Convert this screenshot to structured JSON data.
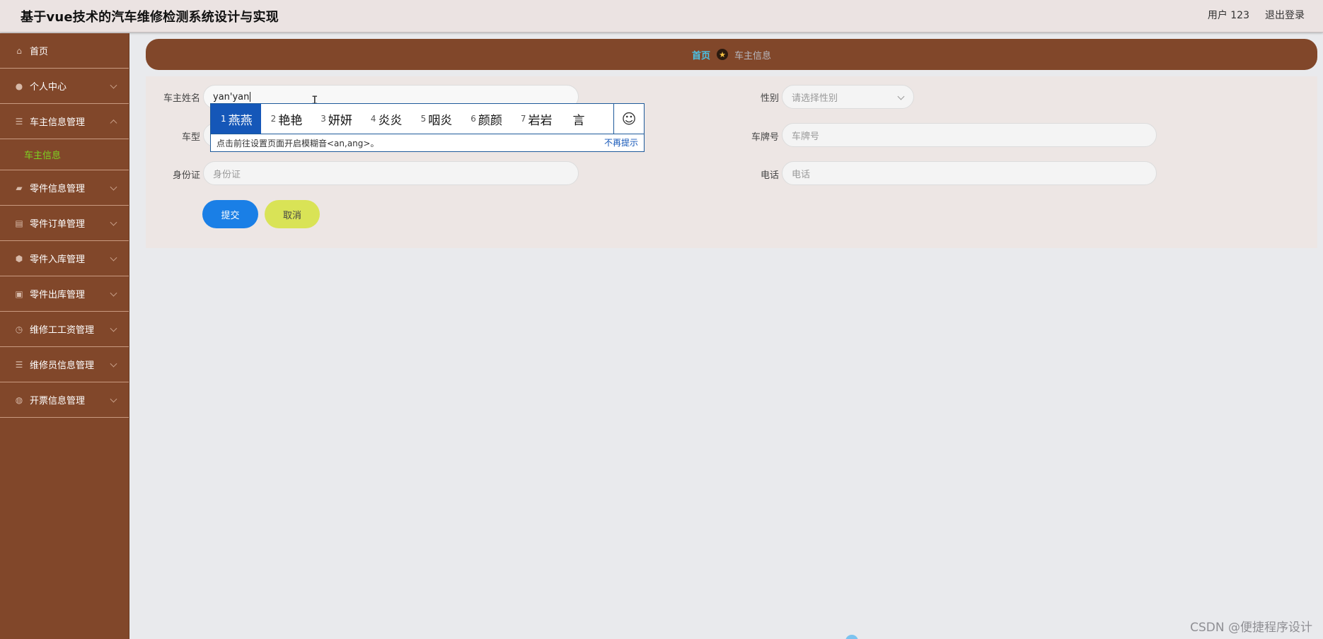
{
  "header": {
    "title": "基于vue技术的汽车维修检测系统设计与实现",
    "user": "用户 123",
    "logout": "退出登录"
  },
  "sidebar": {
    "items": [
      {
        "label": "首页",
        "icon": "home-icon"
      },
      {
        "label": "个人中心",
        "icon": "user-icon"
      },
      {
        "label": "车主信息管理",
        "icon": "list-icon",
        "expanded": true,
        "children": [
          {
            "label": "车主信息"
          }
        ]
      },
      {
        "label": "零件信息管理",
        "icon": "box-icon"
      },
      {
        "label": "零件订单管理",
        "icon": "order-icon"
      },
      {
        "label": "零件入库管理",
        "icon": "shield-icon"
      },
      {
        "label": "零件出库管理",
        "icon": "clipboard-icon"
      },
      {
        "label": "维修工工资管理",
        "icon": "clock-icon"
      },
      {
        "label": "维修员信息管理",
        "icon": "list-icon"
      },
      {
        "label": "开票信息管理",
        "icon": "globe-icon"
      }
    ]
  },
  "breadcrumb": {
    "home": "首页",
    "current": "车主信息"
  },
  "form": {
    "owner_name": {
      "label": "车主姓名",
      "value": "yan'yan"
    },
    "gender": {
      "label": "性别",
      "placeholder": "请选择性别"
    },
    "car_model": {
      "label": "车型"
    },
    "plate": {
      "label": "车牌号",
      "placeholder": "车牌号"
    },
    "id_card": {
      "label": "身份证",
      "placeholder": "身份证"
    },
    "phone": {
      "label": "电话",
      "placeholder": "电话"
    },
    "submit": "提交",
    "cancel": "取消"
  },
  "ime": {
    "candidates": [
      {
        "num": "1",
        "text": "燕燕",
        "selected": true
      },
      {
        "num": "2",
        "text": "艳艳"
      },
      {
        "num": "3",
        "text": "妍妍"
      },
      {
        "num": "4",
        "text": "炎炎"
      },
      {
        "num": "5",
        "text": "咽炎"
      },
      {
        "num": "6",
        "text": "颜颜"
      },
      {
        "num": "7",
        "text": "岩岩"
      },
      {
        "num": "",
        "text": "言"
      }
    ],
    "emoji": "☺",
    "hint": "点击前往设置页面开启模糊音<an,ang>。",
    "dismiss": "不再提示"
  },
  "watermark": "CSDN @便捷程序设计",
  "colors": {
    "sidebar": "#81472a",
    "accent_blue": "#1a7fe6",
    "cancel_yellow": "#d9e356",
    "active_green": "#7ed321"
  }
}
